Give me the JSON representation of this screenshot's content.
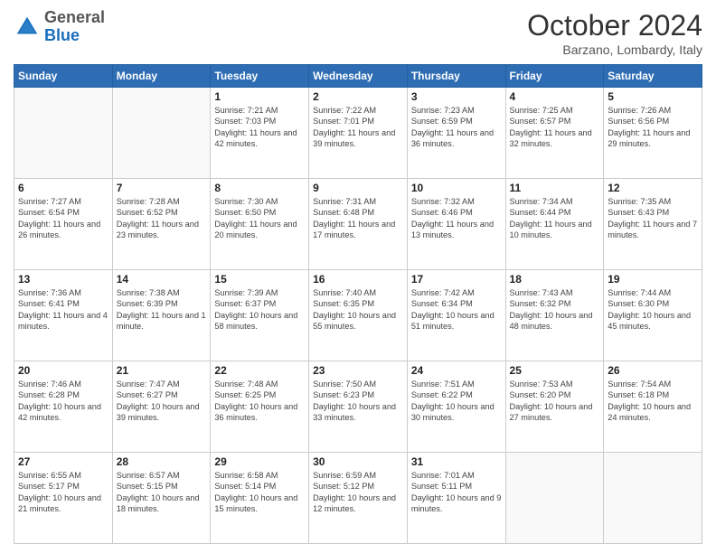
{
  "header": {
    "logo_general": "General",
    "logo_blue": "Blue",
    "month_title": "October 2024",
    "location": "Barzano, Lombardy, Italy"
  },
  "days_of_week": [
    "Sunday",
    "Monday",
    "Tuesday",
    "Wednesday",
    "Thursday",
    "Friday",
    "Saturday"
  ],
  "weeks": [
    [
      {
        "day": "",
        "info": ""
      },
      {
        "day": "",
        "info": ""
      },
      {
        "day": "1",
        "info": "Sunrise: 7:21 AM\nSunset: 7:03 PM\nDaylight: 11 hours and 42 minutes."
      },
      {
        "day": "2",
        "info": "Sunrise: 7:22 AM\nSunset: 7:01 PM\nDaylight: 11 hours and 39 minutes."
      },
      {
        "day": "3",
        "info": "Sunrise: 7:23 AM\nSunset: 6:59 PM\nDaylight: 11 hours and 36 minutes."
      },
      {
        "day": "4",
        "info": "Sunrise: 7:25 AM\nSunset: 6:57 PM\nDaylight: 11 hours and 32 minutes."
      },
      {
        "day": "5",
        "info": "Sunrise: 7:26 AM\nSunset: 6:56 PM\nDaylight: 11 hours and 29 minutes."
      }
    ],
    [
      {
        "day": "6",
        "info": "Sunrise: 7:27 AM\nSunset: 6:54 PM\nDaylight: 11 hours and 26 minutes."
      },
      {
        "day": "7",
        "info": "Sunrise: 7:28 AM\nSunset: 6:52 PM\nDaylight: 11 hours and 23 minutes."
      },
      {
        "day": "8",
        "info": "Sunrise: 7:30 AM\nSunset: 6:50 PM\nDaylight: 11 hours and 20 minutes."
      },
      {
        "day": "9",
        "info": "Sunrise: 7:31 AM\nSunset: 6:48 PM\nDaylight: 11 hours and 17 minutes."
      },
      {
        "day": "10",
        "info": "Sunrise: 7:32 AM\nSunset: 6:46 PM\nDaylight: 11 hours and 13 minutes."
      },
      {
        "day": "11",
        "info": "Sunrise: 7:34 AM\nSunset: 6:44 PM\nDaylight: 11 hours and 10 minutes."
      },
      {
        "day": "12",
        "info": "Sunrise: 7:35 AM\nSunset: 6:43 PM\nDaylight: 11 hours and 7 minutes."
      }
    ],
    [
      {
        "day": "13",
        "info": "Sunrise: 7:36 AM\nSunset: 6:41 PM\nDaylight: 11 hours and 4 minutes."
      },
      {
        "day": "14",
        "info": "Sunrise: 7:38 AM\nSunset: 6:39 PM\nDaylight: 11 hours and 1 minute."
      },
      {
        "day": "15",
        "info": "Sunrise: 7:39 AM\nSunset: 6:37 PM\nDaylight: 10 hours and 58 minutes."
      },
      {
        "day": "16",
        "info": "Sunrise: 7:40 AM\nSunset: 6:35 PM\nDaylight: 10 hours and 55 minutes."
      },
      {
        "day": "17",
        "info": "Sunrise: 7:42 AM\nSunset: 6:34 PM\nDaylight: 10 hours and 51 minutes."
      },
      {
        "day": "18",
        "info": "Sunrise: 7:43 AM\nSunset: 6:32 PM\nDaylight: 10 hours and 48 minutes."
      },
      {
        "day": "19",
        "info": "Sunrise: 7:44 AM\nSunset: 6:30 PM\nDaylight: 10 hours and 45 minutes."
      }
    ],
    [
      {
        "day": "20",
        "info": "Sunrise: 7:46 AM\nSunset: 6:28 PM\nDaylight: 10 hours and 42 minutes."
      },
      {
        "day": "21",
        "info": "Sunrise: 7:47 AM\nSunset: 6:27 PM\nDaylight: 10 hours and 39 minutes."
      },
      {
        "day": "22",
        "info": "Sunrise: 7:48 AM\nSunset: 6:25 PM\nDaylight: 10 hours and 36 minutes."
      },
      {
        "day": "23",
        "info": "Sunrise: 7:50 AM\nSunset: 6:23 PM\nDaylight: 10 hours and 33 minutes."
      },
      {
        "day": "24",
        "info": "Sunrise: 7:51 AM\nSunset: 6:22 PM\nDaylight: 10 hours and 30 minutes."
      },
      {
        "day": "25",
        "info": "Sunrise: 7:53 AM\nSunset: 6:20 PM\nDaylight: 10 hours and 27 minutes."
      },
      {
        "day": "26",
        "info": "Sunrise: 7:54 AM\nSunset: 6:18 PM\nDaylight: 10 hours and 24 minutes."
      }
    ],
    [
      {
        "day": "27",
        "info": "Sunrise: 6:55 AM\nSunset: 5:17 PM\nDaylight: 10 hours and 21 minutes."
      },
      {
        "day": "28",
        "info": "Sunrise: 6:57 AM\nSunset: 5:15 PM\nDaylight: 10 hours and 18 minutes."
      },
      {
        "day": "29",
        "info": "Sunrise: 6:58 AM\nSunset: 5:14 PM\nDaylight: 10 hours and 15 minutes."
      },
      {
        "day": "30",
        "info": "Sunrise: 6:59 AM\nSunset: 5:12 PM\nDaylight: 10 hours and 12 minutes."
      },
      {
        "day": "31",
        "info": "Sunrise: 7:01 AM\nSunset: 5:11 PM\nDaylight: 10 hours and 9 minutes."
      },
      {
        "day": "",
        "info": ""
      },
      {
        "day": "",
        "info": ""
      }
    ]
  ]
}
